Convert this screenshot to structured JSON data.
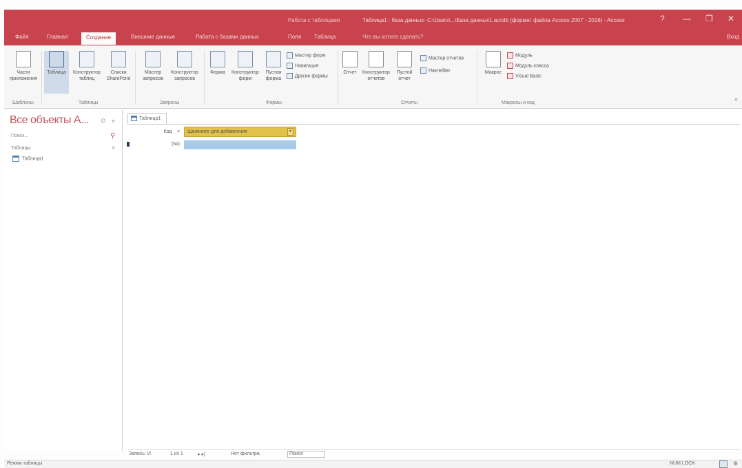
{
  "titlebar": {
    "caption": "Таблица1 : база данных- C:\\Users\\...\\База данных1.accdb (формат файла Access 2007 - 2016) - Access",
    "context_tools": "Работа с таблицами",
    "controls": [
      "?",
      "—",
      "❐",
      "✕"
    ]
  },
  "tabs": {
    "file": "Файл",
    "home": "Главная",
    "create": "Создание",
    "external": "Внешние данные",
    "dbtools": "Работа с базами данных",
    "fields": "Поля",
    "table": "Таблица",
    "tellme": "Что вы хотите сделать?",
    "user": "Вход"
  },
  "ribbon": {
    "groups": {
      "templates": "Шаблоны",
      "tables": "Таблицы",
      "queries": "Запросы",
      "forms": "Формы",
      "reports": "Отчеты",
      "macros": "Макросы и код"
    },
    "buttons": {
      "app_parts": "Части приложения",
      "table": "Таблица",
      "table_design": "Конструктор таблиц",
      "sharepoint_lists": "Списки SharePoint",
      "query_wizard": "Мастер запросов",
      "query_design": "Конструктор запросов",
      "form": "Форма",
      "form_design": "Конструктор форм",
      "blank_form": "Пустая форма",
      "form_wizard": "Мастер форм",
      "navigation": "Навигация",
      "more_forms": "Другие формы",
      "report": "Отчет",
      "report_design": "Конструктор отчетов",
      "blank_report": "Пустой отчет",
      "report_wizard": "Мастер отчетов",
      "labels": "Наклейки",
      "macro": "Макрос",
      "module": "Модуль",
      "class_module": "Модуль класса",
      "visual_basic": "Visual Basic"
    }
  },
  "navpane": {
    "title": "Все объекты A...",
    "search_placeholder": "Поиск...",
    "group": "Таблицы",
    "items": [
      {
        "label": "Таблица1"
      }
    ]
  },
  "document": {
    "tab_label": "Таблица1",
    "columns": {
      "id": "Код",
      "add": "Щелкните для добавления"
    },
    "new_row": {
      "id": "(№)"
    }
  },
  "recnav": {
    "record_label": "Запись: И",
    "position": "1 из 1",
    "nav_buttons": "▸ ▸|",
    "filter_label": "Нет фильтра",
    "search_placeholder": "Поиск"
  },
  "statusbar": {
    "mode": "Режим таблицы",
    "numlock": "NUM LOCK"
  },
  "colors": {
    "accent": "#c8434d",
    "add_column_header": "#e3c14a",
    "new_record_cell": "#a8cbe9"
  }
}
